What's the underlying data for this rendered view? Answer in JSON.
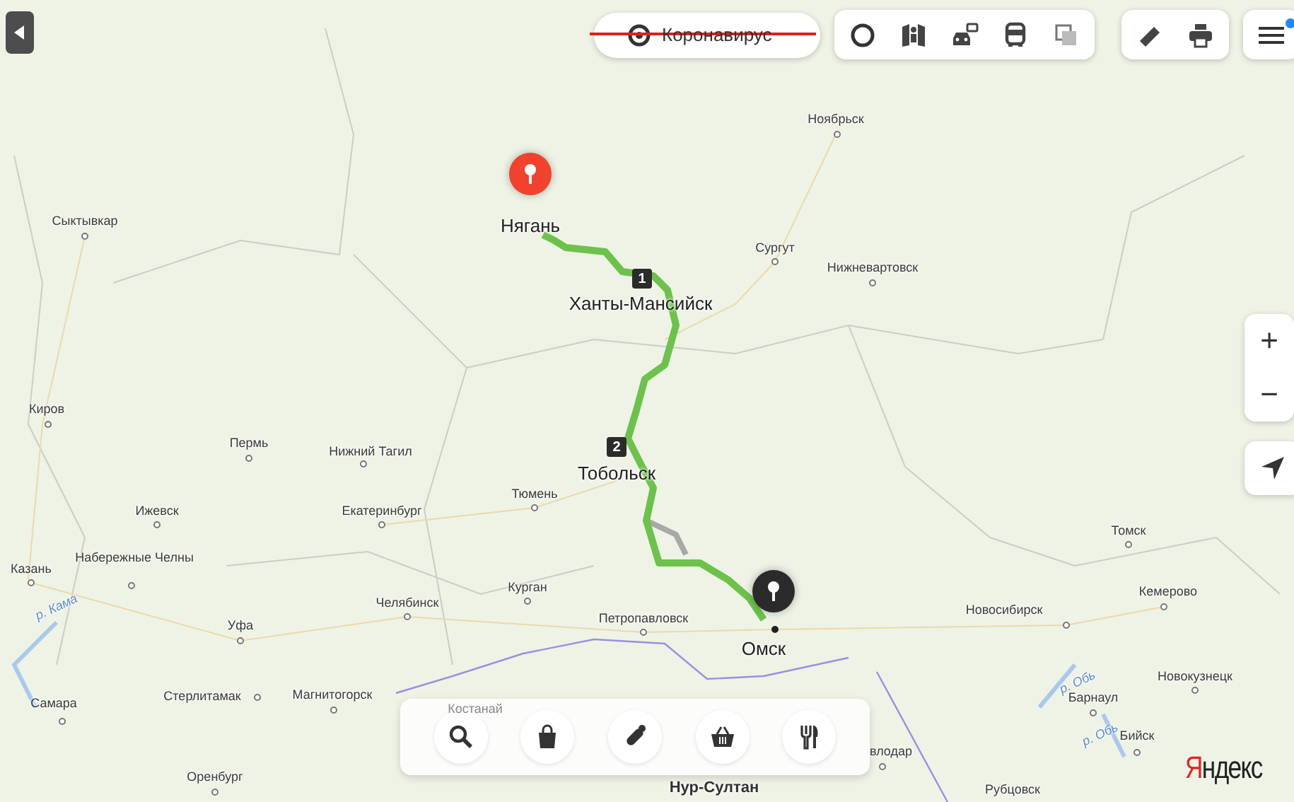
{
  "top_bar": {
    "covid_button": {
      "label": "Коронавирус",
      "crossed_out": true
    },
    "layer_buttons": [
      {
        "kind": "ring"
      },
      {
        "kind": "panorama"
      },
      {
        "kind": "car-camera"
      },
      {
        "kind": "bus"
      },
      {
        "kind": "layers"
      }
    ],
    "tool_buttons": [
      {
        "kind": "ruler"
      },
      {
        "kind": "print"
      }
    ],
    "menu": {
      "notification": true
    }
  },
  "map": {
    "places": [
      {
        "name": "Ноябрьск",
        "kind": "city"
      },
      {
        "name": "Сыктывкар",
        "kind": "city"
      },
      {
        "name": "Нягань",
        "kind": "route"
      },
      {
        "name": "Сургут",
        "kind": "city"
      },
      {
        "name": "Нижневартовск",
        "kind": "city"
      },
      {
        "name": "Ханты-Мансийск",
        "kind": "route"
      },
      {
        "name": "Киров",
        "kind": "city"
      },
      {
        "name": "Пермь",
        "kind": "city"
      },
      {
        "name": "Нижний Тагил",
        "kind": "city"
      },
      {
        "name": "Тобольск",
        "kind": "route"
      },
      {
        "name": "Ижевск",
        "kind": "city"
      },
      {
        "name": "Екатеринбург",
        "kind": "city"
      },
      {
        "name": "Тюмень",
        "kind": "city"
      },
      {
        "name": "Томск",
        "kind": "city"
      },
      {
        "name": "Казань",
        "kind": "city"
      },
      {
        "name": "Набережные Челны",
        "kind": "city"
      },
      {
        "name": "Курган",
        "kind": "city"
      },
      {
        "name": "Кемерово",
        "kind": "city"
      },
      {
        "name": "Челябинск",
        "kind": "city"
      },
      {
        "name": "Петропавловск",
        "kind": "city"
      },
      {
        "name": "Новосибирск",
        "kind": "city"
      },
      {
        "name": "Омск",
        "kind": "route"
      },
      {
        "name": "Уфа",
        "kind": "city"
      },
      {
        "name": "р. Кама",
        "kind": "river"
      },
      {
        "name": "Новокузнецк",
        "kind": "city"
      },
      {
        "name": "Самара",
        "kind": "city"
      },
      {
        "name": "Стерлитамак",
        "kind": "city"
      },
      {
        "name": "Магнитогорск",
        "kind": "city"
      },
      {
        "name": "Барнаул",
        "kind": "city"
      },
      {
        "name": "Костанай",
        "kind": "faded"
      },
      {
        "name": "р. Обь",
        "kind": "river"
      },
      {
        "name": "р. Обь",
        "kind": "river"
      },
      {
        "name": "Бийск",
        "kind": "city"
      },
      {
        "name": "Оренбург",
        "kind": "city"
      },
      {
        "name": "влодар",
        "kind": "city"
      },
      {
        "name": "Нур-Султан",
        "kind": "capital"
      },
      {
        "name": "Рубцовск",
        "kind": "city"
      }
    ],
    "route_markers": [
      "1",
      "2"
    ],
    "pins": [
      {
        "kind": "start"
      },
      {
        "kind": "end"
      }
    ]
  },
  "zoom": {
    "in": "+",
    "out": "−"
  },
  "categories": [
    {
      "kind": "search"
    },
    {
      "kind": "shopping"
    },
    {
      "kind": "pharmacy"
    },
    {
      "kind": "groceries"
    },
    {
      "kind": "food"
    }
  ],
  "logo": "Яндекс"
}
